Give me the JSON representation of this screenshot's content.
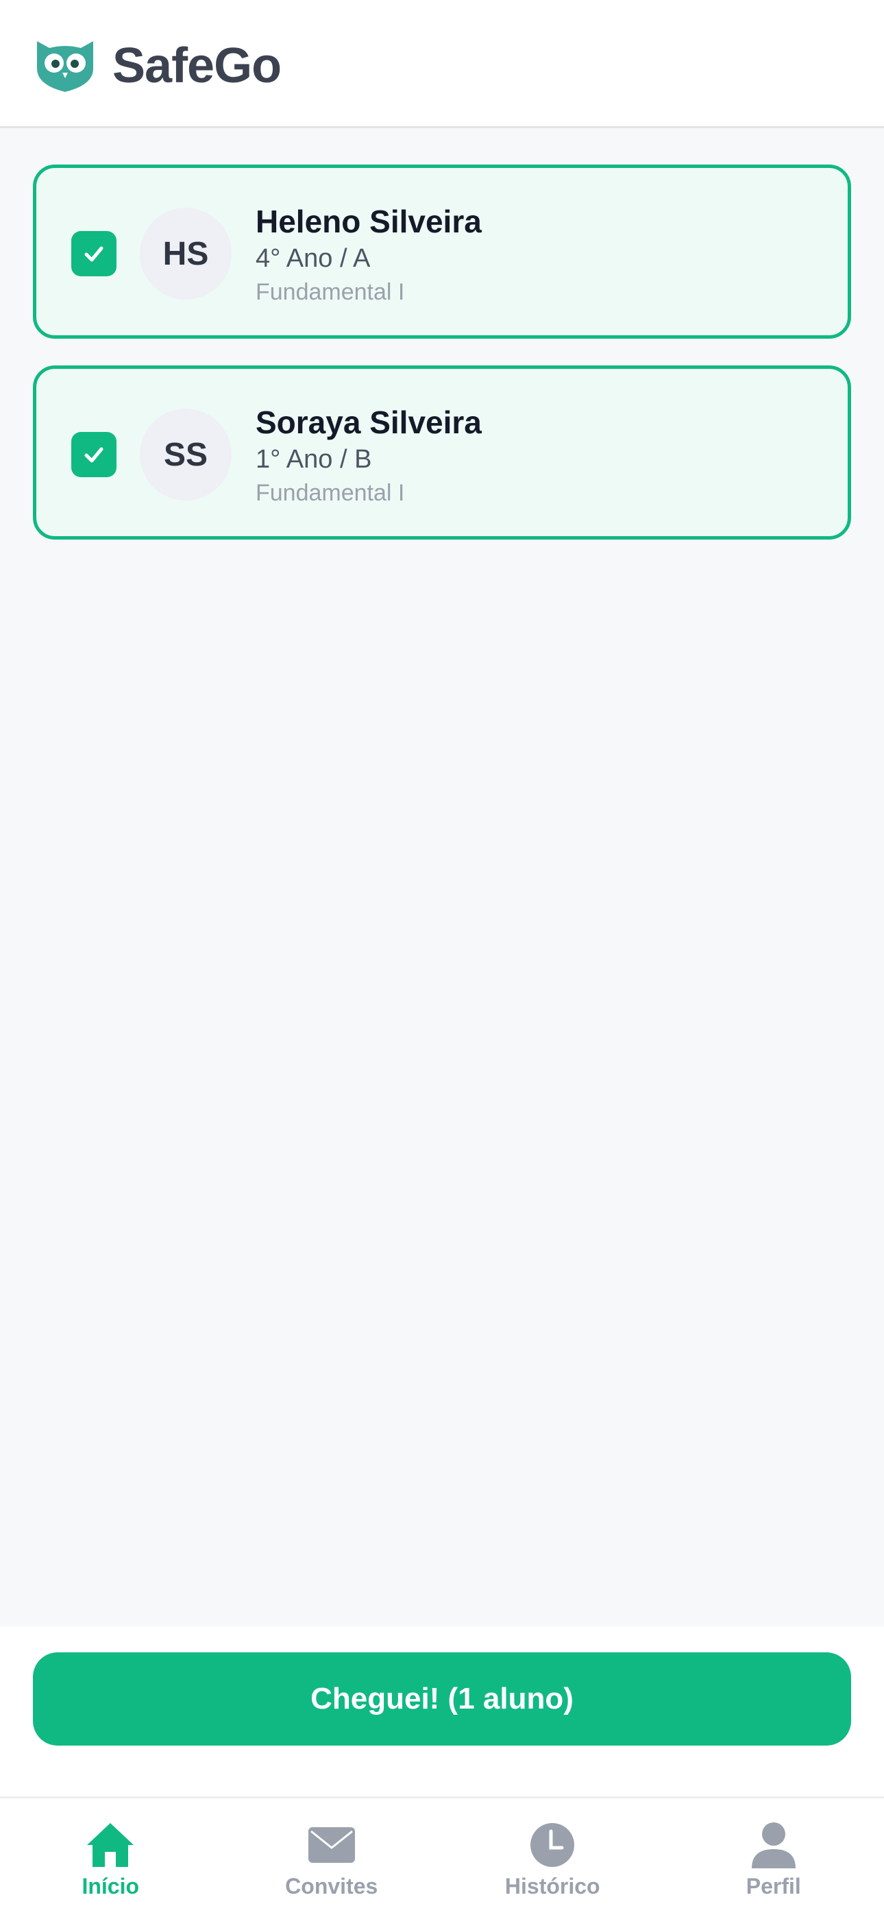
{
  "app": {
    "name": "SafeGo",
    "brand_color": "#10b981",
    "logo_color": "#3ba99c"
  },
  "students": [
    {
      "initials": "HS",
      "name": "Heleno Silveira",
      "grade": "4° Ano / A",
      "level": "Fundamental I",
      "selected": true
    },
    {
      "initials": "SS",
      "name": "Soraya Silveira",
      "grade": "1° Ano / B",
      "level": "Fundamental I",
      "selected": true
    }
  ],
  "action": {
    "label": "Cheguei! (1 aluno)"
  },
  "tabs": [
    {
      "label": "Início",
      "icon": "home-icon",
      "active": true
    },
    {
      "label": "Convites",
      "icon": "envelope-icon",
      "active": false
    },
    {
      "label": "Histórico",
      "icon": "clock-icon",
      "active": false
    },
    {
      "label": "Perfil",
      "icon": "user-icon",
      "active": false
    }
  ],
  "colors": {
    "active_tab": "#10b981",
    "inactive_tab": "#9aa1ac",
    "card_bg": "#eefaf5",
    "page_bg": "#f7f8fa"
  }
}
